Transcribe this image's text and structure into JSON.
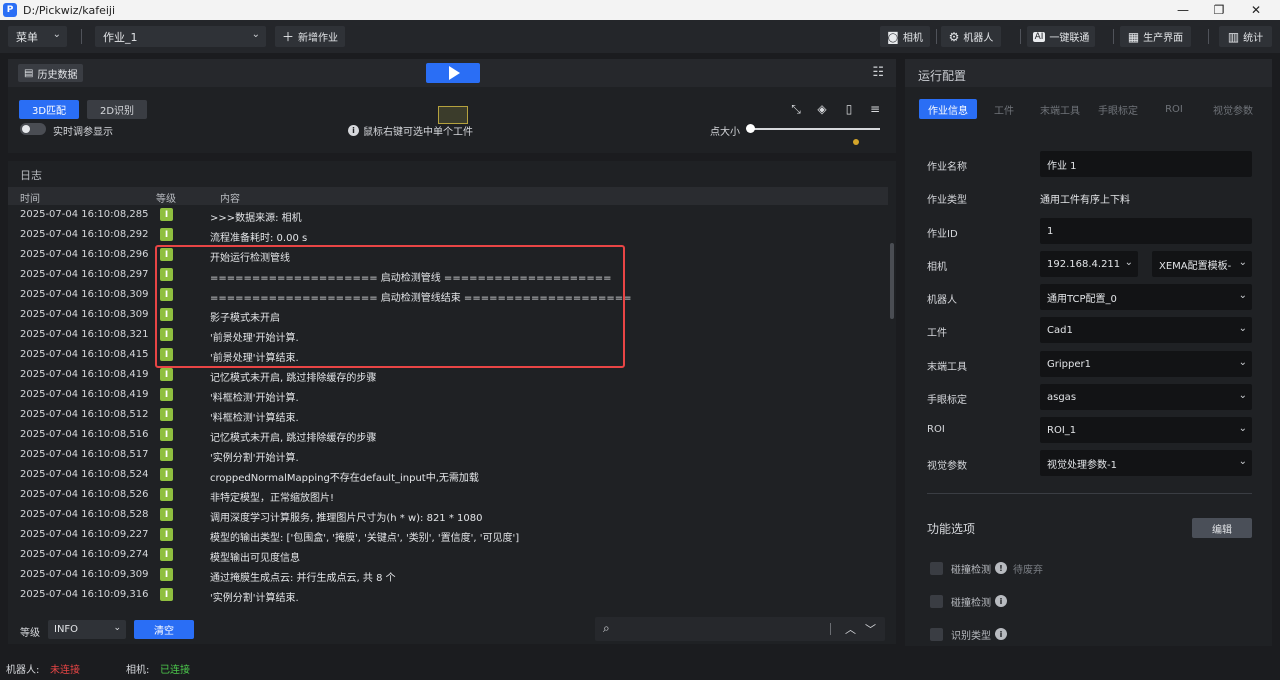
{
  "window": {
    "title": "D:/Pickwiz/kafeiji",
    "min": "—",
    "max": "❐",
    "close": "✕"
  },
  "toolbar": {
    "menu": "菜单",
    "job_select": "作业_1",
    "new_job": "新增作业",
    "camera": "相机",
    "robot": "机器人",
    "one_click": "一键联通",
    "production": "生产界面",
    "stats": "统计"
  },
  "viewer": {
    "history": "历史数据",
    "mode_3d": "3D匹配",
    "mode_2d": "2D识别",
    "realtime_label": "实时调参显示",
    "hint": "鼠标右键可选中单个工件",
    "point_size_label": "点大小",
    "point_size_value": 0.0
  },
  "log": {
    "title": "日志",
    "columns": {
      "time": "时间",
      "level": "等级",
      "content": "内容"
    },
    "level_glyph": "I",
    "rows": [
      {
        "time": "2025-07-04 16:10:08,285",
        "content": ">>>数据来源: 相机"
      },
      {
        "time": "2025-07-04 16:10:08,292",
        "content": "流程准备耗时: 0.00 s"
      },
      {
        "time": "2025-07-04 16:10:08,296",
        "content": "开始运行检测管线"
      },
      {
        "time": "2025-07-04 16:10:08,297",
        "content": "==================== 启动检测管线 ===================="
      },
      {
        "time": "2025-07-04 16:10:08,309",
        "content": "==================== 启动检测管线结束 ===================="
      },
      {
        "time": "2025-07-04 16:10:08,309",
        "content": "影子模式未开启"
      },
      {
        "time": "2025-07-04 16:10:08,321",
        "content": "'前景处理'开始计算."
      },
      {
        "time": "2025-07-04 16:10:08,415",
        "content": "'前景处理'计算结束."
      },
      {
        "time": "2025-07-04 16:10:08,419",
        "content": "记忆模式未开启, 跳过排除缓存的步骤"
      },
      {
        "time": "2025-07-04 16:10:08,419",
        "content": "'料框检测'开始计算."
      },
      {
        "time": "2025-07-04 16:10:08,512",
        "content": "'料框检测'计算结束."
      },
      {
        "time": "2025-07-04 16:10:08,516",
        "content": "记忆模式未开启, 跳过排除缓存的步骤"
      },
      {
        "time": "2025-07-04 16:10:08,517",
        "content": "'实例分割'开始计算."
      },
      {
        "time": "2025-07-04 16:10:08,524",
        "content": "croppedNormalMapping不存在default_input中,无需加载"
      },
      {
        "time": "2025-07-04 16:10:08,526",
        "content": "非特定模型，正常缩放图片!"
      },
      {
        "time": "2025-07-04 16:10:08,528",
        "content": "调用深度学习计算服务, 推理图片尺寸为(h * w): 821 * 1080"
      },
      {
        "time": "2025-07-04 16:10:09,227",
        "content": "模型的输出类型: ['包围盒', '掩膜', '关键点', '类别', '置信度', '可见度']"
      },
      {
        "time": "2025-07-04 16:10:09,274",
        "content": "模型输出可见度信息"
      },
      {
        "time": "2025-07-04 16:10:09,309",
        "content": "通过掩膜生成点云: 并行生成点云, 共 8 个"
      },
      {
        "time": "2025-07-04 16:10:09,316",
        "content": "'实例分割'计算结束."
      }
    ],
    "footer": {
      "level_label": "等级",
      "level_value": "INFO",
      "clear": "清空",
      "search_placeholder": ""
    }
  },
  "config": {
    "title": "运行配置",
    "tabs": [
      "作业信息",
      "工件",
      "末端工具",
      "手眼标定",
      "ROI",
      "视觉参数"
    ],
    "fields": {
      "job_name": {
        "label": "作业名称",
        "value": "作业 1"
      },
      "job_type": {
        "label": "作业类型",
        "value": "通用工件有序上下料"
      },
      "job_id": {
        "label": "作业ID",
        "value": "1"
      },
      "camera": {
        "label": "相机",
        "value": "192.168.4.211",
        "value2": "XEMA配置模板-"
      },
      "robot": {
        "label": "机器人",
        "value": "通用TCP配置_0"
      },
      "workpiece": {
        "label": "工件",
        "value": "Cad1"
      },
      "end_tool": {
        "label": "末端工具",
        "value": "Gripper1"
      },
      "hand_eye": {
        "label": "手眼标定",
        "value": "asgas"
      },
      "roi": {
        "label": "ROI",
        "value": "ROI_1"
      },
      "vision": {
        "label": "视觉参数",
        "value": "视觉处理参数-1"
      }
    },
    "func_title": "功能选项",
    "edit": "编辑",
    "options": [
      {
        "label": "碰撞检测",
        "note": "待废弃"
      },
      {
        "label": "碰撞检测",
        "note": ""
      },
      {
        "label": "识别类型",
        "note": ""
      }
    ]
  },
  "status": {
    "robot_label": "机器人:",
    "robot_state": "未连接",
    "camera_label": "相机:",
    "camera_state": "已连接",
    "color_disconnected": "#e84545",
    "color_connected": "#4cc94c"
  },
  "colors": {
    "accent": "#2a6ef5",
    "highlight": "#e84545",
    "info_badge": "#8fbf3f"
  }
}
